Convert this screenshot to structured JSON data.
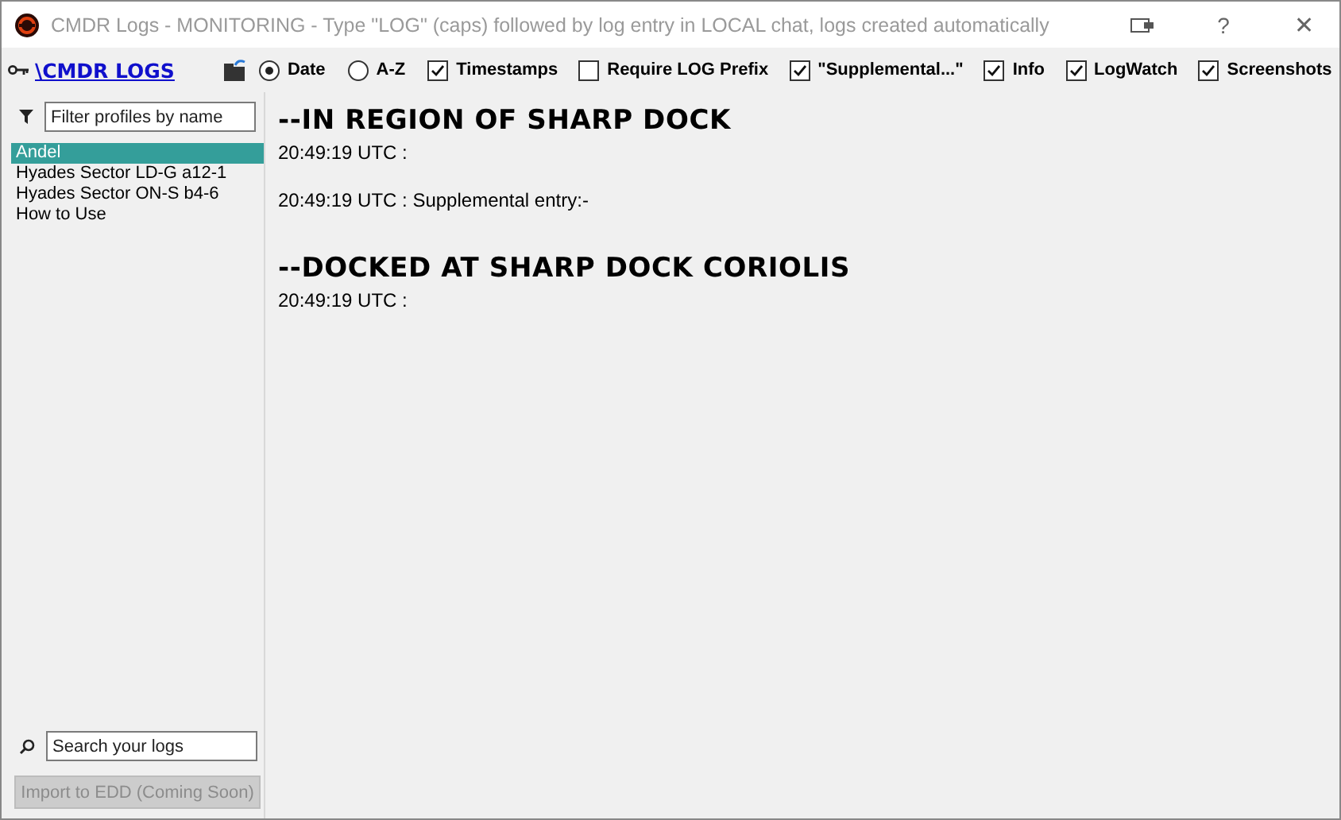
{
  "window": {
    "title": "CMDR Logs - MONITORING - Type \"LOG\" (caps) followed by log entry in LOCAL chat, logs created automatically",
    "buttons": [
      {
        "kind": "help",
        "label": "?"
      },
      {
        "kind": "close",
        "label": "✕"
      }
    ]
  },
  "toolbar": {
    "logo": "\\CMDR LOGS",
    "sort": [
      {
        "label": "Date",
        "selected": true
      },
      {
        "label": "A-Z",
        "selected": false
      }
    ],
    "options": [
      {
        "label": "Timestamps",
        "checked": true
      },
      {
        "label": "Require LOG Prefix",
        "checked": false
      },
      {
        "label": "\"Supplemental...\"",
        "checked": true
      },
      {
        "label": "Info",
        "checked": true
      },
      {
        "label": "LogWatch",
        "checked": true
      },
      {
        "label": "Screenshots",
        "checked": true
      }
    ]
  },
  "sidebar": {
    "filter": {
      "placeholder": "Filter profiles by name"
    },
    "items": [
      {
        "label": "Andel",
        "selected": true
      },
      {
        "label": "Hyades Sector LD-G a12-1",
        "selected": false
      },
      {
        "label": "Hyades Sector ON-S b4-6",
        "selected": false
      },
      {
        "label": "How to Use",
        "selected": false
      }
    ],
    "search": {
      "placeholder": "Search your logs"
    },
    "import_button": {
      "label": "Import to EDD (Coming Soon)",
      "disabled": true
    }
  },
  "log": [
    {
      "kind": "heading",
      "text": "--IN REGION OF SHARP DOCK"
    },
    {
      "kind": "entry",
      "text": "20:49:19 UTC :"
    },
    {
      "kind": "entry",
      "text": "20:49:19 UTC : Supplemental entry:-"
    },
    {
      "kind": "heading",
      "text": "--DOCKED AT SHARP DOCK CORIOLIS"
    },
    {
      "kind": "entry",
      "text": "20:49:19 UTC :"
    }
  ]
}
